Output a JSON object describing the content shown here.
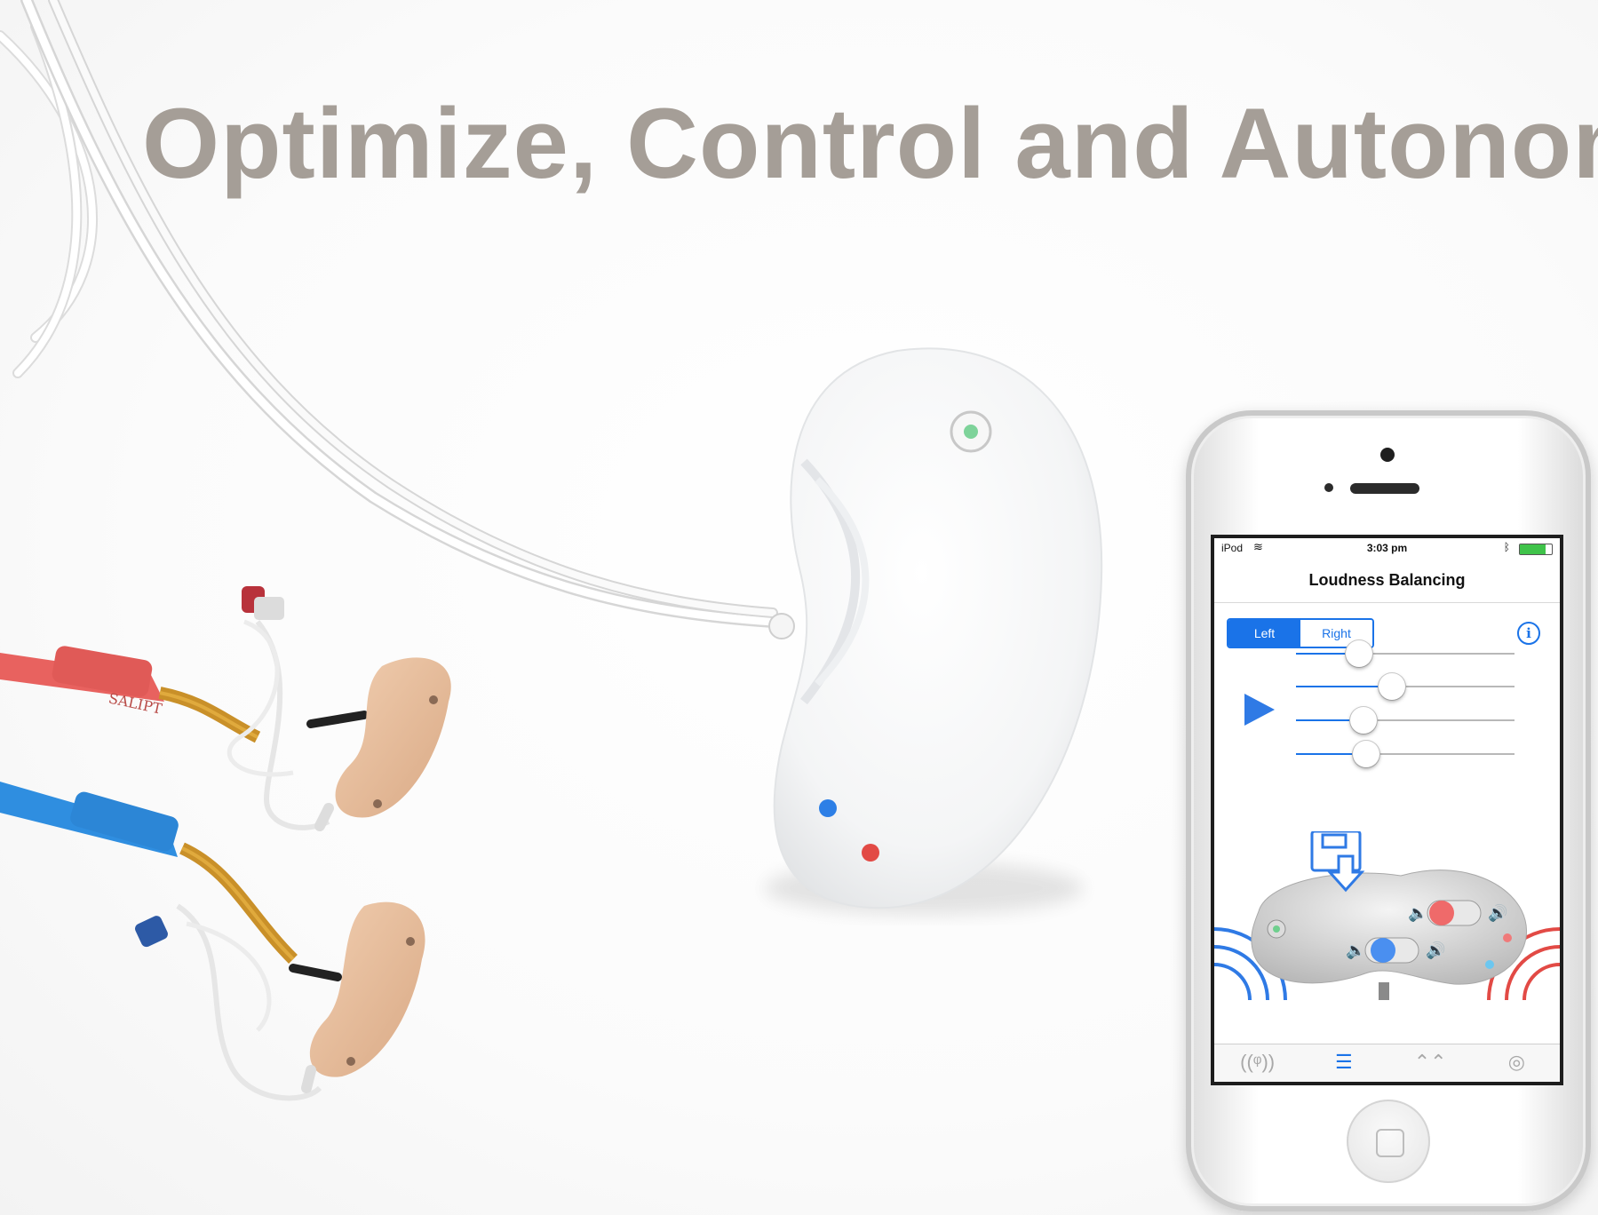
{
  "headline": "Optimize, Control and Autonomy",
  "colors": {
    "headline": "#a59e97",
    "accent_blue": "#1a73e8",
    "left_channel_red": "#e8625f",
    "right_channel_blue": "#2f8ee0",
    "skin": "#e9bf9e"
  },
  "earpiece_print": "SALIPT",
  "phone": {
    "status": {
      "carrier": "iPod",
      "wifi_icon": "wifi-icon",
      "time": "3:03 pm",
      "bluetooth_icon": "bluetooth-icon",
      "battery_icon": "battery-icon"
    },
    "title": "Loudness Balancing",
    "segments": {
      "left": "Left",
      "right": "Right",
      "selected": "Left"
    },
    "info_glyph": "i",
    "play_icon": "play-icon",
    "sliders": [
      0.29,
      0.44,
      0.31,
      0.32
    ],
    "tabs": [
      {
        "icon": "antenna-icon",
        "glyph": "((ᵠ))"
      },
      {
        "icon": "equalizer-icon",
        "glyph": "☰",
        "active": true
      },
      {
        "icon": "chevrons-icon",
        "glyph": "⌃⌃"
      },
      {
        "icon": "lifebuoy-icon",
        "glyph": "◎"
      }
    ]
  }
}
